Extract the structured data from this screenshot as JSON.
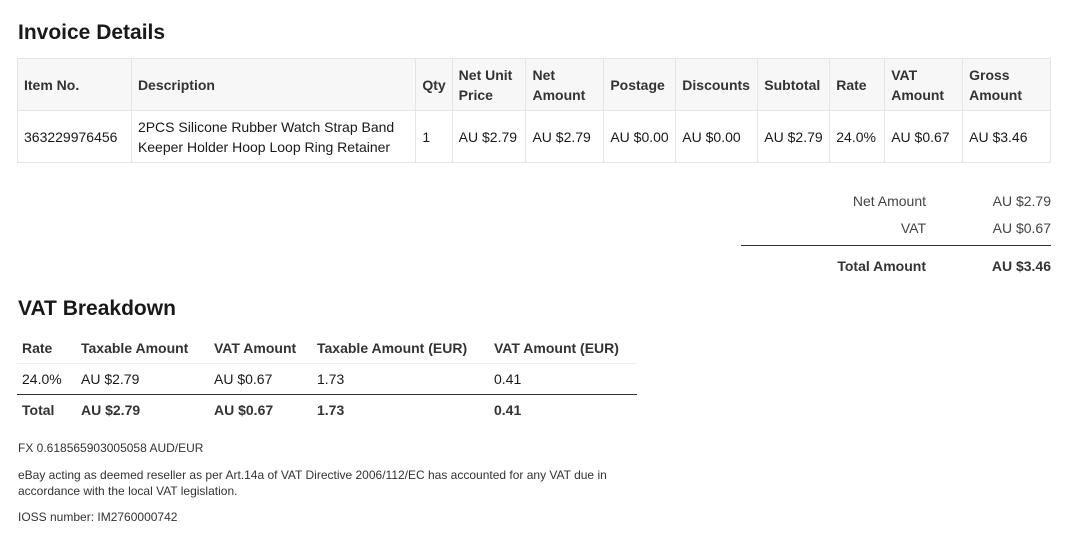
{
  "invoice": {
    "title": "Invoice Details",
    "columns": [
      "Item No.",
      "Description",
      "Qty",
      "Net Unit Price",
      "Net Amount",
      "Postage",
      "Discounts",
      "Subtotal",
      "Rate",
      "VAT Amount",
      "Gross Amount"
    ],
    "rows": [
      {
        "item_no": "363229976456",
        "description": "2PCS Silicone Rubber Watch Strap Band Keeper Holder Hoop Loop Ring Retainer",
        "qty": "1",
        "net_unit_price": "AU $2.79",
        "net_amount": "AU $2.79",
        "postage": "AU $0.00",
        "discounts": "AU $0.00",
        "subtotal": "AU $2.79",
        "rate": "24.0%",
        "vat_amount": "AU $0.67",
        "gross_amount": "AU $3.46"
      }
    ]
  },
  "summary": {
    "net_amount_label": "Net Amount",
    "net_amount_value": "AU $2.79",
    "vat_label": "VAT",
    "vat_value": "AU $0.67",
    "total_label": "Total Amount",
    "total_value": "AU $3.46"
  },
  "vat_breakdown": {
    "title": "VAT Breakdown",
    "columns": [
      "Rate",
      "Taxable Amount",
      "VAT Amount",
      "Taxable Amount (EUR)",
      "VAT Amount (EUR)"
    ],
    "rows": [
      {
        "rate": "24.0%",
        "taxable": "AU $2.79",
        "vat": "AU $0.67",
        "taxable_eur": "1.73",
        "vat_eur": "0.41"
      }
    ],
    "total": {
      "label": "Total",
      "taxable": "AU $2.79",
      "vat": "AU $0.67",
      "taxable_eur": "1.73",
      "vat_eur": "0.41"
    }
  },
  "notes": {
    "fx": "FX 0.618565903005058 AUD/EUR",
    "reseller": "eBay acting as deemed reseller as per Art.14a of VAT Directive 2006/112/EC has accounted for any VAT due in accordance with the local VAT legislation.",
    "ioss": "IOSS number: IM2760000742"
  }
}
